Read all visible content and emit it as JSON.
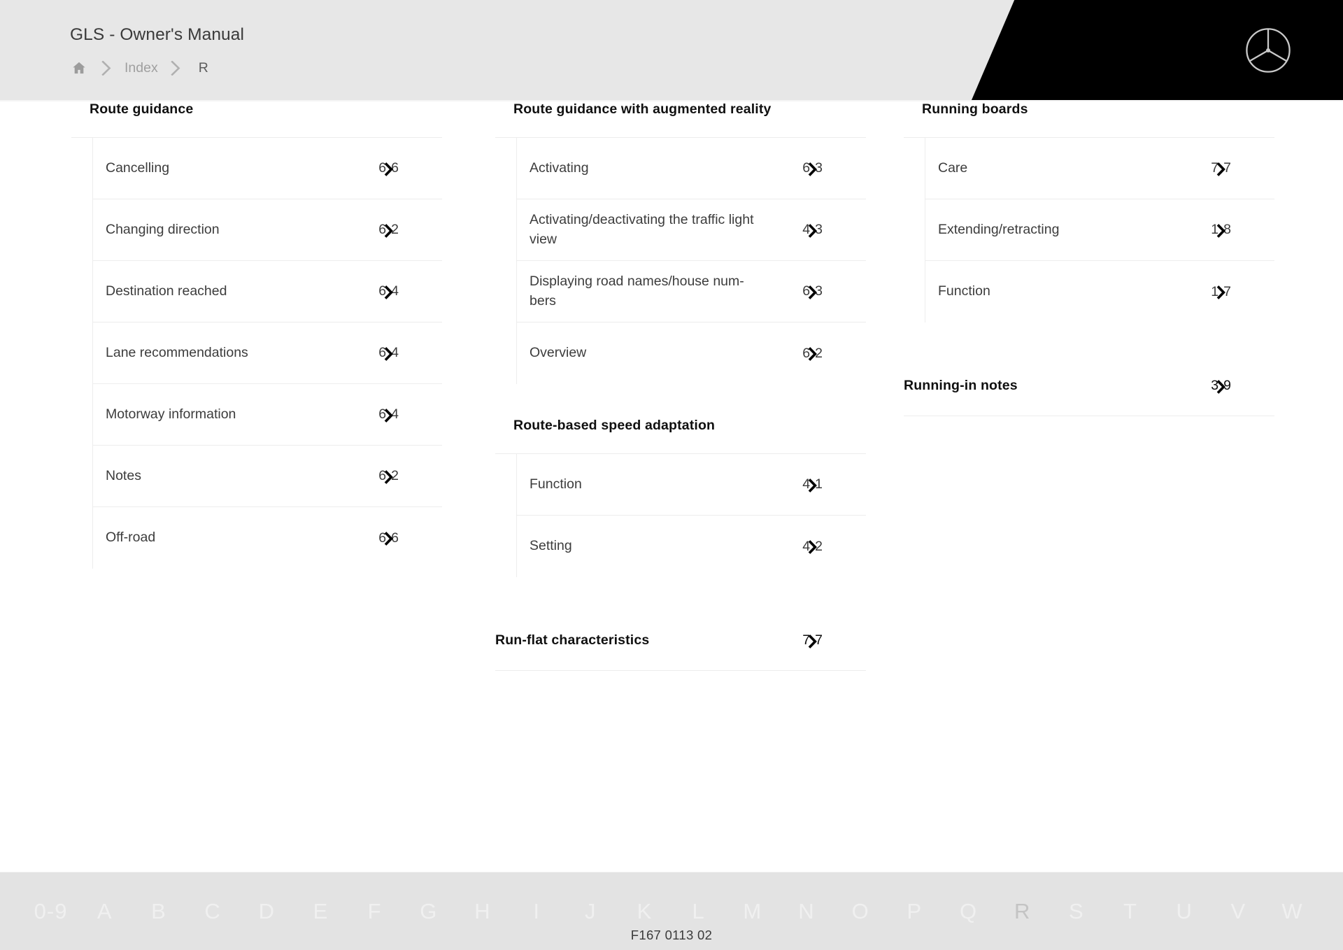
{
  "header": {
    "manual_title": "GLS - Owner's Manual",
    "breadcrumb": {
      "home_icon": "home-icon",
      "separator_icon": "chevron-right-icon",
      "index_label": "Index",
      "current_label": "R"
    },
    "brand_logo": "mercedes-benz-star-icon"
  },
  "columns": [
    {
      "groups": [
        {
          "heading": "Route guidance",
          "heading_pageref": null,
          "items": [
            {
              "label": "Cancelling",
              "chapter": "6",
              "page": "6"
            },
            {
              "label": "Changing direction",
              "chapter": "6",
              "page": "2"
            },
            {
              "label": "Destination reached",
              "chapter": "6",
              "page": "4"
            },
            {
              "label": "Lane recommendations",
              "chapter": "6",
              "page": "4"
            },
            {
              "label": "Motorway information",
              "chapter": "6",
              "page": "4"
            },
            {
              "label": "Notes",
              "chapter": "6",
              "page": "2"
            },
            {
              "label": "Off-road",
              "chapter": "6",
              "page": "6"
            }
          ]
        }
      ]
    },
    {
      "groups": [
        {
          "heading": "Route guidance with augmented reality",
          "heading_pageref": null,
          "items": [
            {
              "label": "Activating",
              "chapter": "6",
              "page": "3"
            },
            {
              "label": "Activating/deactivating the traffic light view",
              "chapter": "4",
              "page": "3"
            },
            {
              "label": "Displaying road names/house num-bers",
              "chapter": "6",
              "page": "3"
            },
            {
              "label": "Overview",
              "chapter": "6",
              "page": "2"
            }
          ]
        },
        {
          "heading": "Route-based speed adaptation",
          "heading_pageref": null,
          "items": [
            {
              "label": "Function",
              "chapter": "4",
              "page": "1"
            },
            {
              "label": "Setting",
              "chapter": "4",
              "page": "2"
            }
          ]
        },
        {
          "heading": "Run-flat characteristics",
          "heading_pageref": {
            "chapter": "7",
            "page": "7"
          },
          "items": []
        }
      ]
    },
    {
      "groups": [
        {
          "heading": "Running boards",
          "heading_pageref": null,
          "items": [
            {
              "label": "Care",
              "chapter": "7",
              "page": "7"
            },
            {
              "label": "Extending/retracting",
              "chapter": "1",
              "page": "8"
            },
            {
              "label": "Function",
              "chapter": "1",
              "page": "7"
            }
          ]
        },
        {
          "heading": "Running-in notes",
          "heading_pageref": {
            "chapter": "3",
            "page": "9"
          },
          "items": []
        }
      ]
    }
  ],
  "alphabet_bar": {
    "letters": [
      "0-9",
      "A",
      "B",
      "C",
      "D",
      "E",
      "F",
      "G",
      "H",
      "I",
      "J",
      "K",
      "L",
      "M",
      "N",
      "O",
      "P",
      "Q",
      "R",
      "S",
      "T",
      "U",
      "V",
      "W"
    ],
    "active_letter": "R"
  },
  "footer": {
    "document_code": "F167 0113 02"
  },
  "colors": {
    "header_bg": "#e7e7e7",
    "banner_black": "#000000",
    "rule": "#ededed",
    "text_primary": "#101010",
    "text_body": "#3c3c3c",
    "alpha_bar_bg": "#e3e3e3",
    "alpha_letter": "#f0f0f0",
    "alpha_letter_active": "#c4c4c4"
  }
}
